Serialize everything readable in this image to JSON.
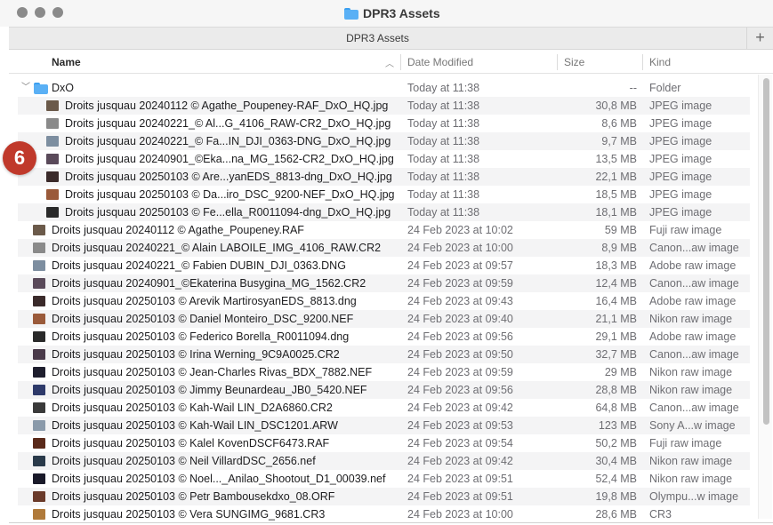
{
  "window": {
    "title": "DPR3 Assets"
  },
  "tabbar": {
    "tab_title": "DPR3 Assets",
    "add_label": "+"
  },
  "columns": {
    "name": "Name",
    "date": "Date Modified",
    "size": "Size",
    "kind": "Kind"
  },
  "badge": {
    "label": "6",
    "color": "#c0392b"
  },
  "folder": {
    "name": "DxO",
    "date": "Today at 11:38",
    "size": "--",
    "kind": "Folder"
  },
  "children": [
    {
      "name": "Droits jusquau 20240112 © Agathe_Poupeney-RAF_DxO_HQ.jpg",
      "date": "Today at 11:38",
      "size": "30,8 MB",
      "kind": "JPEG image",
      "thumb": "#6b5a4a"
    },
    {
      "name": "Droits jusquau 20240221_© Al...G_4106_RAW-CR2_DxO_HQ.jpg",
      "date": "Today at 11:38",
      "size": "8,6 MB",
      "kind": "JPEG image",
      "thumb": "#8a8a8a"
    },
    {
      "name": "Droits jusquau 20240221_© Fa...IN_DJI_0363-DNG_DxO_HQ.jpg",
      "date": "Today at 11:38",
      "size": "9,7 MB",
      "kind": "JPEG image",
      "thumb": "#7d8ea0"
    },
    {
      "name": "Droits jusquau 20240901_©Eka...na_MG_1562-CR2_DxO_HQ.jpg",
      "date": "Today at 11:38",
      "size": "13,5 MB",
      "kind": "JPEG image",
      "thumb": "#5a4a5a"
    },
    {
      "name": "Droits jusquau 20250103 © Are...yanEDS_8813-dng_DxO_HQ.jpg",
      "date": "Today at 11:38",
      "size": "22,1 MB",
      "kind": "JPEG image",
      "thumb": "#3a2a2a"
    },
    {
      "name": "Droits jusquau 20250103 © Da...iro_DSC_9200-NEF_DxO_HQ.jpg",
      "date": "Today at 11:38",
      "size": "18,5 MB",
      "kind": "JPEG image",
      "thumb": "#9a5a3a"
    },
    {
      "name": "Droits jusquau 20250103 © Fe...ella_R0011094-dng_DxO_HQ.jpg",
      "date": "Today at 11:38",
      "size": "18,1 MB",
      "kind": "JPEG image",
      "thumb": "#2a2a2a"
    }
  ],
  "files": [
    {
      "name": "Droits jusquau 20240112 © Agathe_Poupeney.RAF",
      "date": "24 Feb 2023 at 10:02",
      "size": "59 MB",
      "kind": "Fuji raw image",
      "thumb": "#6b5a4a"
    },
    {
      "name": "Droits jusquau 20240221_© Alain LABOILE_IMG_4106_RAW.CR2",
      "date": "24 Feb 2023 at 10:00",
      "size": "8,9 MB",
      "kind": "Canon...aw image",
      "thumb": "#8a8a8a"
    },
    {
      "name": "Droits jusquau 20240221_© Fabien DUBIN_DJI_0363.DNG",
      "date": "24 Feb 2023 at 09:57",
      "size": "18,3 MB",
      "kind": "Adobe raw image",
      "thumb": "#7d8ea0"
    },
    {
      "name": "Droits jusquau 20240901_©Ekaterina Busygina_MG_1562.CR2",
      "date": "24 Feb 2023 at 09:59",
      "size": "12,4 MB",
      "kind": "Canon...aw image",
      "thumb": "#5a4a5a"
    },
    {
      "name": "Droits jusquau 20250103 © Arevik MartirosyanEDS_8813.dng",
      "date": "24 Feb 2023 at 09:43",
      "size": "16,4 MB",
      "kind": "Adobe raw image",
      "thumb": "#3a2a2a"
    },
    {
      "name": "Droits jusquau 20250103 © Daniel Monteiro_DSC_9200.NEF",
      "date": "24 Feb 2023 at 09:40",
      "size": "21,1 MB",
      "kind": "Nikon raw image",
      "thumb": "#9a5a3a"
    },
    {
      "name": "Droits jusquau 20250103 © Federico Borella_R0011094.dng",
      "date": "24 Feb 2023 at 09:56",
      "size": "29,1 MB",
      "kind": "Adobe raw image",
      "thumb": "#2a2a2a"
    },
    {
      "name": "Droits jusquau 20250103 © Irina Werning_9C9A0025.CR2",
      "date": "24 Feb 2023 at 09:50",
      "size": "32,7 MB",
      "kind": "Canon...aw image",
      "thumb": "#4a3a4a"
    },
    {
      "name": "Droits jusquau 20250103 © Jean-Charles Rivas_BDX_7882.NEF",
      "date": "24 Feb 2023 at 09:59",
      "size": "29 MB",
      "kind": "Nikon raw image",
      "thumb": "#1e1e2e"
    },
    {
      "name": "Droits jusquau 20250103 © Jimmy Beunardeau_JB0_5420.NEF",
      "date": "24 Feb 2023 at 09:56",
      "size": "28,8 MB",
      "kind": "Nikon raw image",
      "thumb": "#2e3a6a"
    },
    {
      "name": "Droits jusquau 20250103 © Kah-Wail LIN_D2A6860.CR2",
      "date": "24 Feb 2023 at 09:42",
      "size": "64,8 MB",
      "kind": "Canon...aw image",
      "thumb": "#3a3a3a"
    },
    {
      "name": "Droits jusquau 20250103 © Kah-Wail LIN_DSC1201.ARW",
      "date": "24 Feb 2023 at 09:53",
      "size": "123 MB",
      "kind": "Sony A...w image",
      "thumb": "#8a9aaa"
    },
    {
      "name": "Droits jusquau 20250103 © Kalel KovenDSCF6473.RAF",
      "date": "24 Feb 2023 at 09:54",
      "size": "50,2 MB",
      "kind": "Fuji raw image",
      "thumb": "#5a2a1a"
    },
    {
      "name": "Droits jusquau 20250103 © Neil VillardDSC_2656.nef",
      "date": "24 Feb 2023 at 09:42",
      "size": "30,4 MB",
      "kind": "Nikon raw image",
      "thumb": "#2a3a4a"
    },
    {
      "name": "Droits jusquau 20250103 © Noel..._Anilao_Shootout_D1_00039.nef",
      "date": "24 Feb 2023 at 09:51",
      "size": "52,4 MB",
      "kind": "Nikon raw image",
      "thumb": "#1a1a2a"
    },
    {
      "name": "Droits jusquau 20250103 © Petr Bambousekdxo_08.ORF",
      "date": "24 Feb 2023 at 09:51",
      "size": "19,8 MB",
      "kind": "Olympu...w image",
      "thumb": "#6a3a2a"
    },
    {
      "name": "Droits jusquau 20250103 © Vera SUNGIMG_9681.CR3",
      "date": "24 Feb 2023 at 10:00",
      "size": "28,6 MB",
      "kind": "CR3",
      "thumb": "#b07a3a"
    }
  ]
}
